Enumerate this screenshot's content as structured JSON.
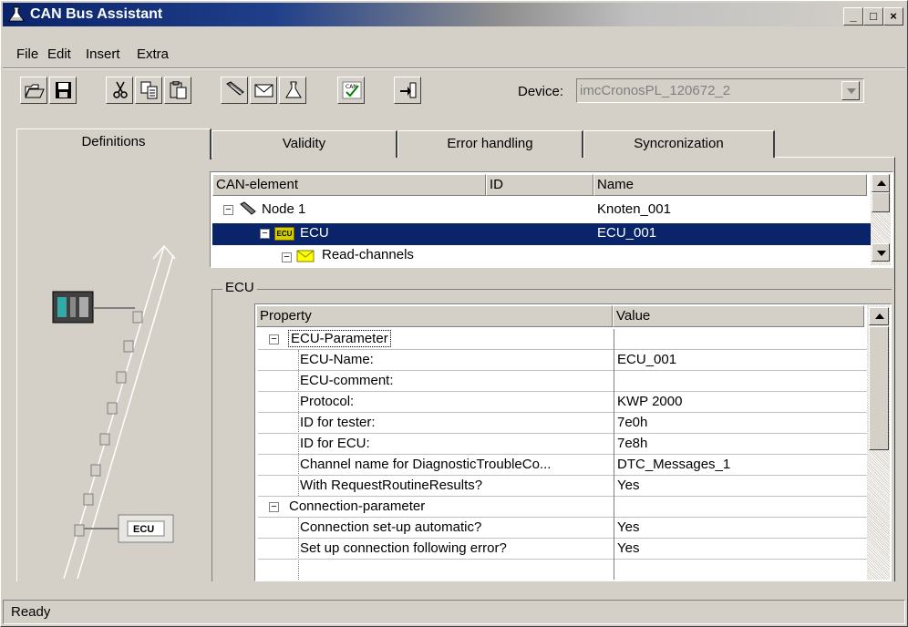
{
  "window": {
    "title": "CAN Bus Assistant",
    "buttons": {
      "minimize": "_",
      "maximize": "□",
      "close": "×"
    }
  },
  "menu": [
    {
      "label": "File"
    },
    {
      "label": "Edit"
    },
    {
      "label": "Insert"
    },
    {
      "label": "Extra"
    }
  ],
  "toolbar": {
    "device_label": "Device:",
    "device_value": "imcCronosPL_120672_2",
    "icons": [
      "open-folder-icon",
      "save-icon",
      "cut-icon",
      "copy-icon",
      "paste-icon",
      "node-icon",
      "message-icon",
      "flask-icon",
      "can-check-icon",
      "import-icon"
    ]
  },
  "tabs": [
    {
      "label": "Definitions",
      "active": true
    },
    {
      "label": "Validity"
    },
    {
      "label": "Error handling"
    },
    {
      "label": "Syncronization"
    }
  ],
  "tree": {
    "headers": {
      "element": "CAN-element",
      "id": "ID",
      "name": "Name"
    },
    "rows": [
      {
        "element": "Node 1",
        "name": "Knoten_001"
      },
      {
        "element": "ECU",
        "name": "ECU_001",
        "selected": true
      },
      {
        "element": "Read-channels",
        "name": ""
      }
    ]
  },
  "ecu_group": {
    "label": "ECU",
    "headers": {
      "property": "Property",
      "value": "Value"
    },
    "sections": [
      {
        "name": "ECU-Parameter",
        "rows": [
          {
            "property": "ECU-Name:",
            "value": "ECU_001"
          },
          {
            "property": "ECU-comment:",
            "value": ""
          },
          {
            "property": "Protocol:",
            "value": "KWP 2000"
          },
          {
            "property": "ID for tester:",
            "value": "7e0h"
          },
          {
            "property": "ID for ECU:",
            "value": "7e8h"
          },
          {
            "property": "Channel name for DiagnosticTroubleCo...",
            "value": "DTC_Messages_1"
          },
          {
            "property": "With RequestRoutineResults?",
            "value": "Yes"
          }
        ]
      },
      {
        "name": "Connection-parameter",
        "rows": [
          {
            "property": "Connection set-up automatic?",
            "value": "Yes"
          },
          {
            "property": "Set up connection following error?",
            "value": "Yes"
          }
        ]
      }
    ]
  },
  "illustration": {
    "ecu_box_label": "ECU"
  },
  "status": {
    "text": "Ready"
  },
  "colors": {
    "selection": "#0a246a",
    "titlebar": "#0a246a",
    "face": "#d4d0c8"
  }
}
